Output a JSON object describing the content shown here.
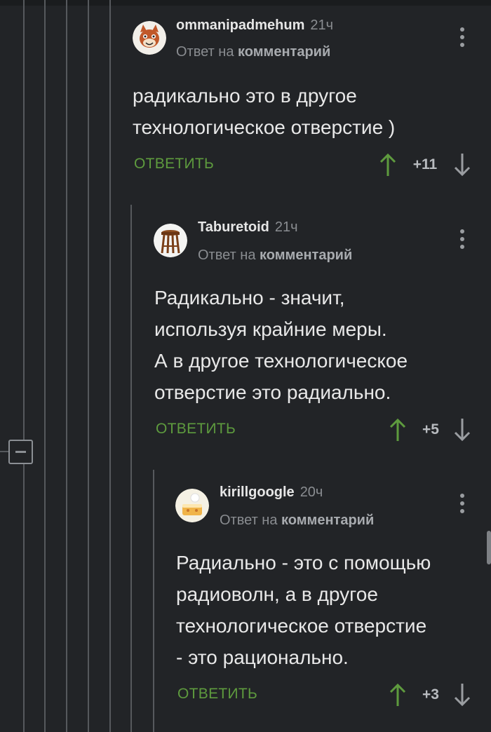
{
  "comments": [
    {
      "author": "ommanipadmehum",
      "time": "21ч",
      "reply_prefix": "Ответ на",
      "reply_link": "комментарий",
      "text": "радикально это в другое\nтехнологическое отверстие )",
      "reply_label": "ОТВЕТИТЬ",
      "score": "+11",
      "avatar_icon": "cartoon-cat-avatar-icon"
    },
    {
      "author": "Taburetoid",
      "time": "21ч",
      "reply_prefix": "Ответ на",
      "reply_link": "комментарий",
      "text": "Радикально - значит,\nиспользуя крайние меры.\nА в другое технологическое\nотверстие это радиально.",
      "reply_label": "ОТВЕТИТЬ",
      "score": "+5",
      "avatar_icon": "stool-avatar-icon"
    },
    {
      "author": "kirillgoogle",
      "time": "20ч",
      "reply_prefix": "Ответ на",
      "reply_link": "комментарий",
      "text": "Радиально - это с помощью\nрадиоволн, а в другое\nтехнологическое отверстие\n- это рационально.",
      "reply_label": "ОТВЕТИТЬ",
      "score": "+3",
      "avatar_icon": "cake-avatar-icon"
    }
  ],
  "colors": {
    "background": "#222427",
    "reply_green": "#5e9b3e",
    "upvote_green": "#5e9b3e",
    "muted_text": "#8a8d91"
  },
  "icons": {
    "more": "kebab-menu-icon",
    "upvote": "arrow-up-icon",
    "downvote": "arrow-down-icon",
    "collapse": "collapse-minus-icon"
  }
}
